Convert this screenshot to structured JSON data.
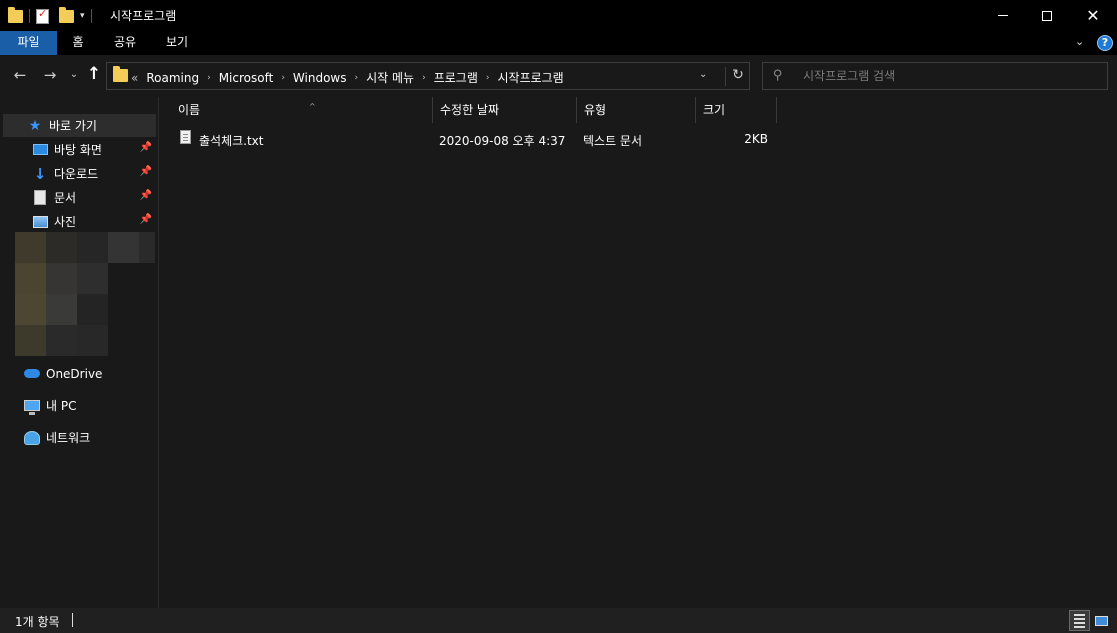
{
  "window": {
    "title": "시작프로그램",
    "minimize_icon": "minimize-icon",
    "maximize_icon": "maximize-icon",
    "close_icon": "close-icon",
    "close_glyph": "✕"
  },
  "ribbon": {
    "tabs": [
      {
        "label": "파일",
        "active": true
      },
      {
        "label": "홈",
        "active": false
      },
      {
        "label": "공유",
        "active": false
      },
      {
        "label": "보기",
        "active": false
      }
    ],
    "expand_glyph": "⌄",
    "help_glyph": "?"
  },
  "navigation": {
    "back_glyph": "←",
    "forward_glyph": "→",
    "recent_glyph": "⌄",
    "up_glyph": "↑"
  },
  "address_bar": {
    "overflow": "«",
    "breadcrumbs": [
      "Roaming",
      "Microsoft",
      "Windows",
      "시작 메뉴",
      "프로그램",
      "시작프로그램"
    ],
    "separator": "›",
    "dropdown_glyph": "⌄",
    "refresh_glyph": "↻"
  },
  "search": {
    "placeholder": "시작프로그램 검색",
    "value": "",
    "icon": "search-icon",
    "icon_glyph": "⚲"
  },
  "nav_pane": {
    "quick_access": {
      "label": "바로 가기",
      "icon": "star-icon",
      "glyph": "★"
    },
    "pinned": [
      {
        "label": "바탕 화면",
        "icon": "desktop-icon"
      },
      {
        "label": "다운로드",
        "icon": "download-icon"
      },
      {
        "label": "문서",
        "icon": "document-icon"
      },
      {
        "label": "사진",
        "icon": "pictures-icon"
      }
    ],
    "pin_glyph": "📌",
    "download_glyph": "↓",
    "onedrive": {
      "label": "OneDrive",
      "icon": "onedrive-icon"
    },
    "this_pc": {
      "label": "내 PC",
      "icon": "pc-icon"
    },
    "network": {
      "label": "네트워크",
      "icon": "network-icon"
    }
  },
  "file_list": {
    "columns": [
      "이름",
      "수정한 날짜",
      "유형",
      "크기"
    ],
    "sort_glyph": "^",
    "files": [
      {
        "name": "출석체크.txt",
        "modified": "2020-09-08 오후 4:37",
        "type": "텍스트 문서",
        "size": "2KB",
        "icon": "text-file-icon"
      }
    ]
  },
  "status_bar": {
    "item_count": "1개 항목"
  },
  "colors": {
    "accent": "#1a5ea8",
    "background": "#191919",
    "titlebar": "#000000"
  }
}
